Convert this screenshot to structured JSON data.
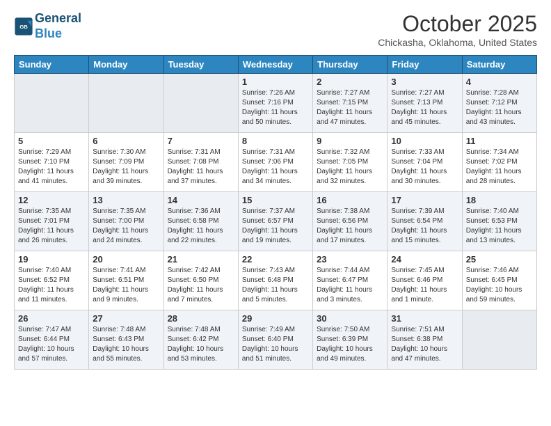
{
  "header": {
    "logo_line1": "General",
    "logo_line2": "Blue",
    "month": "October 2025",
    "location": "Chickasha, Oklahoma, United States"
  },
  "weekdays": [
    "Sunday",
    "Monday",
    "Tuesday",
    "Wednesday",
    "Thursday",
    "Friday",
    "Saturday"
  ],
  "weeks": [
    [
      {
        "day": "",
        "sunrise": "",
        "sunset": "",
        "daylight": "",
        "empty": true
      },
      {
        "day": "",
        "sunrise": "",
        "sunset": "",
        "daylight": "",
        "empty": true
      },
      {
        "day": "",
        "sunrise": "",
        "sunset": "",
        "daylight": "",
        "empty": true
      },
      {
        "day": "1",
        "sunrise": "Sunrise: 7:26 AM",
        "sunset": "Sunset: 7:16 PM",
        "daylight": "Daylight: 11 hours and 50 minutes.",
        "empty": false
      },
      {
        "day": "2",
        "sunrise": "Sunrise: 7:27 AM",
        "sunset": "Sunset: 7:15 PM",
        "daylight": "Daylight: 11 hours and 47 minutes.",
        "empty": false
      },
      {
        "day": "3",
        "sunrise": "Sunrise: 7:27 AM",
        "sunset": "Sunset: 7:13 PM",
        "daylight": "Daylight: 11 hours and 45 minutes.",
        "empty": false
      },
      {
        "day": "4",
        "sunrise": "Sunrise: 7:28 AM",
        "sunset": "Sunset: 7:12 PM",
        "daylight": "Daylight: 11 hours and 43 minutes.",
        "empty": false
      }
    ],
    [
      {
        "day": "5",
        "sunrise": "Sunrise: 7:29 AM",
        "sunset": "Sunset: 7:10 PM",
        "daylight": "Daylight: 11 hours and 41 minutes.",
        "empty": false
      },
      {
        "day": "6",
        "sunrise": "Sunrise: 7:30 AM",
        "sunset": "Sunset: 7:09 PM",
        "daylight": "Daylight: 11 hours and 39 minutes.",
        "empty": false
      },
      {
        "day": "7",
        "sunrise": "Sunrise: 7:31 AM",
        "sunset": "Sunset: 7:08 PM",
        "daylight": "Daylight: 11 hours and 37 minutes.",
        "empty": false
      },
      {
        "day": "8",
        "sunrise": "Sunrise: 7:31 AM",
        "sunset": "Sunset: 7:06 PM",
        "daylight": "Daylight: 11 hours and 34 minutes.",
        "empty": false
      },
      {
        "day": "9",
        "sunrise": "Sunrise: 7:32 AM",
        "sunset": "Sunset: 7:05 PM",
        "daylight": "Daylight: 11 hours and 32 minutes.",
        "empty": false
      },
      {
        "day": "10",
        "sunrise": "Sunrise: 7:33 AM",
        "sunset": "Sunset: 7:04 PM",
        "daylight": "Daylight: 11 hours and 30 minutes.",
        "empty": false
      },
      {
        "day": "11",
        "sunrise": "Sunrise: 7:34 AM",
        "sunset": "Sunset: 7:02 PM",
        "daylight": "Daylight: 11 hours and 28 minutes.",
        "empty": false
      }
    ],
    [
      {
        "day": "12",
        "sunrise": "Sunrise: 7:35 AM",
        "sunset": "Sunset: 7:01 PM",
        "daylight": "Daylight: 11 hours and 26 minutes.",
        "empty": false
      },
      {
        "day": "13",
        "sunrise": "Sunrise: 7:35 AM",
        "sunset": "Sunset: 7:00 PM",
        "daylight": "Daylight: 11 hours and 24 minutes.",
        "empty": false
      },
      {
        "day": "14",
        "sunrise": "Sunrise: 7:36 AM",
        "sunset": "Sunset: 6:58 PM",
        "daylight": "Daylight: 11 hours and 22 minutes.",
        "empty": false
      },
      {
        "day": "15",
        "sunrise": "Sunrise: 7:37 AM",
        "sunset": "Sunset: 6:57 PM",
        "daylight": "Daylight: 11 hours and 19 minutes.",
        "empty": false
      },
      {
        "day": "16",
        "sunrise": "Sunrise: 7:38 AM",
        "sunset": "Sunset: 6:56 PM",
        "daylight": "Daylight: 11 hours and 17 minutes.",
        "empty": false
      },
      {
        "day": "17",
        "sunrise": "Sunrise: 7:39 AM",
        "sunset": "Sunset: 6:54 PM",
        "daylight": "Daylight: 11 hours and 15 minutes.",
        "empty": false
      },
      {
        "day": "18",
        "sunrise": "Sunrise: 7:40 AM",
        "sunset": "Sunset: 6:53 PM",
        "daylight": "Daylight: 11 hours and 13 minutes.",
        "empty": false
      }
    ],
    [
      {
        "day": "19",
        "sunrise": "Sunrise: 7:40 AM",
        "sunset": "Sunset: 6:52 PM",
        "daylight": "Daylight: 11 hours and 11 minutes.",
        "empty": false
      },
      {
        "day": "20",
        "sunrise": "Sunrise: 7:41 AM",
        "sunset": "Sunset: 6:51 PM",
        "daylight": "Daylight: 11 hours and 9 minutes.",
        "empty": false
      },
      {
        "day": "21",
        "sunrise": "Sunrise: 7:42 AM",
        "sunset": "Sunset: 6:50 PM",
        "daylight": "Daylight: 11 hours and 7 minutes.",
        "empty": false
      },
      {
        "day": "22",
        "sunrise": "Sunrise: 7:43 AM",
        "sunset": "Sunset: 6:48 PM",
        "daylight": "Daylight: 11 hours and 5 minutes.",
        "empty": false
      },
      {
        "day": "23",
        "sunrise": "Sunrise: 7:44 AM",
        "sunset": "Sunset: 6:47 PM",
        "daylight": "Daylight: 11 hours and 3 minutes.",
        "empty": false
      },
      {
        "day": "24",
        "sunrise": "Sunrise: 7:45 AM",
        "sunset": "Sunset: 6:46 PM",
        "daylight": "Daylight: 11 hours and 1 minute.",
        "empty": false
      },
      {
        "day": "25",
        "sunrise": "Sunrise: 7:46 AM",
        "sunset": "Sunset: 6:45 PM",
        "daylight": "Daylight: 10 hours and 59 minutes.",
        "empty": false
      }
    ],
    [
      {
        "day": "26",
        "sunrise": "Sunrise: 7:47 AM",
        "sunset": "Sunset: 6:44 PM",
        "daylight": "Daylight: 10 hours and 57 minutes.",
        "empty": false
      },
      {
        "day": "27",
        "sunrise": "Sunrise: 7:48 AM",
        "sunset": "Sunset: 6:43 PM",
        "daylight": "Daylight: 10 hours and 55 minutes.",
        "empty": false
      },
      {
        "day": "28",
        "sunrise": "Sunrise: 7:48 AM",
        "sunset": "Sunset: 6:42 PM",
        "daylight": "Daylight: 10 hours and 53 minutes.",
        "empty": false
      },
      {
        "day": "29",
        "sunrise": "Sunrise: 7:49 AM",
        "sunset": "Sunset: 6:40 PM",
        "daylight": "Daylight: 10 hours and 51 minutes.",
        "empty": false
      },
      {
        "day": "30",
        "sunrise": "Sunrise: 7:50 AM",
        "sunset": "Sunset: 6:39 PM",
        "daylight": "Daylight: 10 hours and 49 minutes.",
        "empty": false
      },
      {
        "day": "31",
        "sunrise": "Sunrise: 7:51 AM",
        "sunset": "Sunset: 6:38 PM",
        "daylight": "Daylight: 10 hours and 47 minutes.",
        "empty": false
      },
      {
        "day": "",
        "sunrise": "",
        "sunset": "",
        "daylight": "",
        "empty": true
      }
    ]
  ]
}
